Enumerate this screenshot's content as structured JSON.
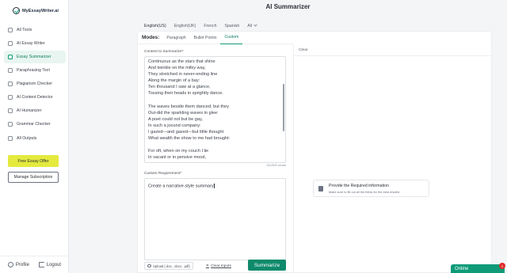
{
  "app": {
    "logo_text": "MyEssayWriter.ai",
    "page_title": "AI Summarizer"
  },
  "sidebar": {
    "items": [
      {
        "label": "All Tools",
        "icon": "grid-icon"
      },
      {
        "label": "AI Essay Writer",
        "icon": "pencil-icon"
      },
      {
        "label": "Essay Summarizer",
        "icon": "document-icon",
        "active": true
      },
      {
        "label": "Paraphrasing Tool",
        "icon": "refresh-icon"
      },
      {
        "label": "Plagiarism Checker",
        "icon": "shield-icon"
      },
      {
        "label": "AI Content Detector",
        "icon": "scan-icon"
      },
      {
        "label": "AI Humanizer",
        "icon": "user-icon"
      },
      {
        "label": "Grammar Checker",
        "icon": "check-icon"
      },
      {
        "label": "All Outputs",
        "icon": "folder-icon"
      }
    ],
    "offer_label": "Free Essay Offer",
    "manage_label": "Manage Subscription",
    "profile_label": "Profile",
    "logout_label": "Logout"
  },
  "languages": {
    "tabs": [
      "English(US)",
      "English(UK)",
      "French",
      "Spanish",
      "All"
    ],
    "active": "English(US)"
  },
  "modes": {
    "label": "Modes:",
    "tabs": [
      "Paragraph",
      "Bullet Points",
      "Custom"
    ],
    "active": "Custom"
  },
  "content": {
    "label": "Content to Summarize*",
    "text": "Continuous as the stars that shine\nAnd twinkle on the milky way,\nThey stretched in never-ending line\nAlong the margin of a bay:\nTen thousand I saw at a glance,\nTossing their heads in sprightly dance.\n\nThe waves beside them danced; but they\nOut-did the sparkling waves in glee:\nA poet could not but be gay,\nIn such a jocund company:\nI gazed—and gazed—but little thought\nWhat wealth the show to me had brought:\n\nFor oft, when on my couch I lie\nIn vacant or in pensive mood,\nThey flash upon that inward eye",
    "word_count": "151/800 words"
  },
  "custom_requirement": {
    "label": "Custom Requirement*",
    "value": "Create a narrative-style summary"
  },
  "actions": {
    "upload_label": "Upload (.doc, .docx, .pdf)",
    "clear_inputs_label": "Clear Inputs",
    "summarize_label": "Summarize"
  },
  "output": {
    "clear_label": "Clear",
    "info_title": "Provide the Required information",
    "info_subtitle": "Make sure to fill out all the fields for the best results!"
  },
  "chat": {
    "label": "Online",
    "badge": "1"
  },
  "colors": {
    "accent": "#0f8a6c",
    "offer": "#e4ea3e",
    "badge": "#e02b2b"
  }
}
